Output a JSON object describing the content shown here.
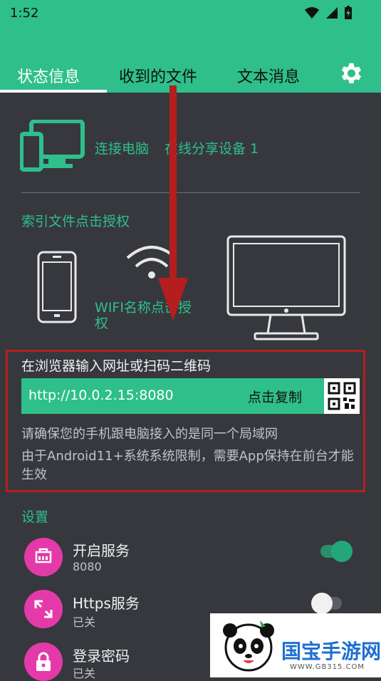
{
  "status_bar": {
    "time": "1:52"
  },
  "tabs": [
    {
      "label": "状态信息"
    },
    {
      "label": "收到的文件"
    },
    {
      "label": "文本消息"
    }
  ],
  "connect": {
    "label": "连接电脑",
    "share": "在线分享设备 1"
  },
  "index_auth": {
    "label": "索引文件点击授权"
  },
  "wifi": {
    "label": "WIFI名称点击授权"
  },
  "browser": {
    "label": "在浏览器输入网址或扫码二维码",
    "url": "http://10.0.2.15:8080",
    "copy": "点击复制",
    "note1": "请确保您的手机跟电脑接入的是同一个局域网",
    "note2": "由于Android11+系统系统限制，需要App保持在前台才能生效"
  },
  "settings": {
    "label": "设置",
    "items": [
      {
        "title": "开启服务",
        "subtitle": "8080",
        "on": true
      },
      {
        "title": "Https服务",
        "subtitle": "已关",
        "on": false
      },
      {
        "title": "登录密码",
        "subtitle": "已关",
        "on": false
      }
    ]
  },
  "watermark": {
    "brand": "国宝手游网",
    "url": "WWW.GB315.COM"
  },
  "colors": {
    "accent": "#2fbf8a",
    "background": "#36383e",
    "icon_bg": "#e43aa9",
    "highlight": "#b51e1e"
  }
}
